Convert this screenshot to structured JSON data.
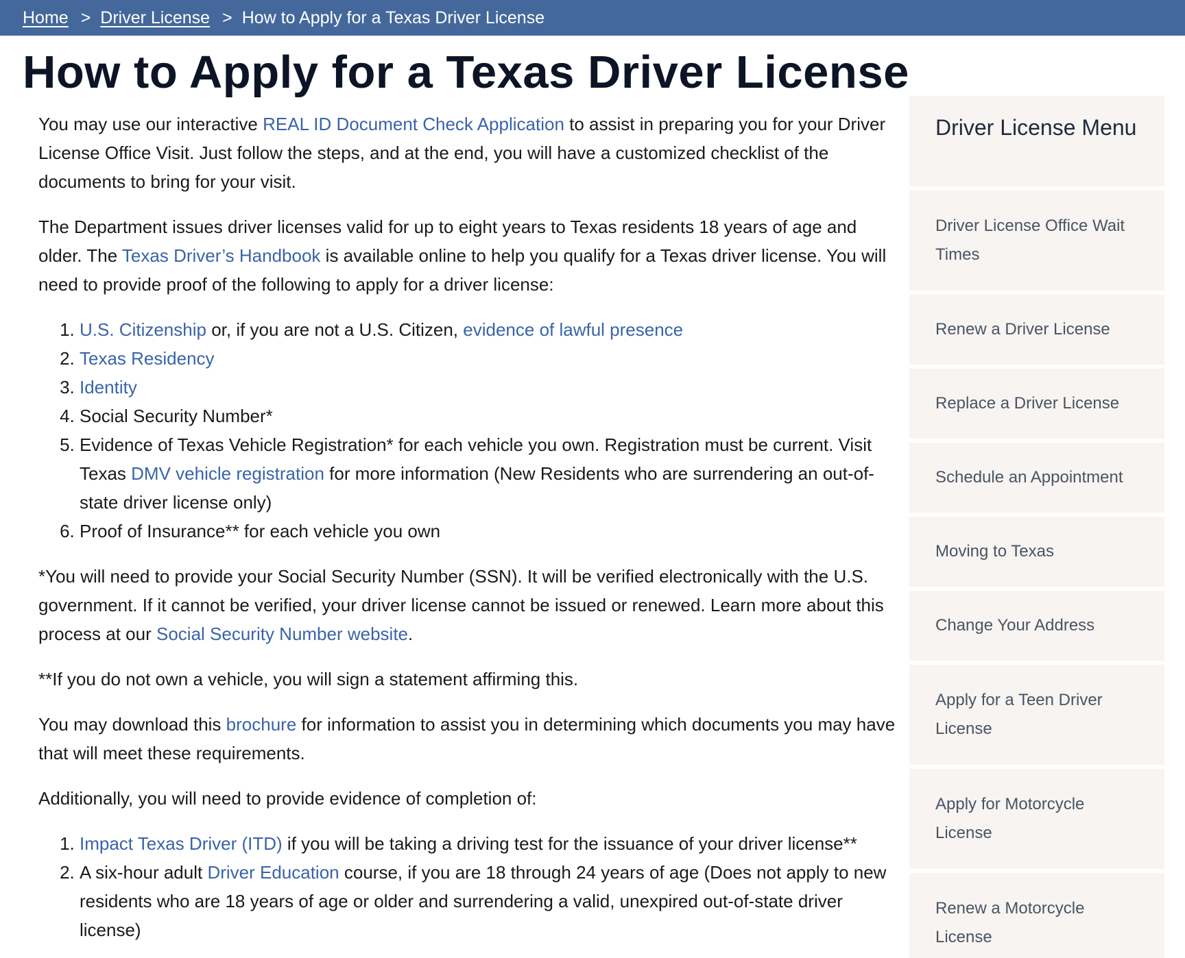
{
  "breadcrumb": {
    "home": "Home",
    "driver_license": "Driver License",
    "current": "How to Apply for a Texas Driver License",
    "separator": ">"
  },
  "title": "How to Apply for a Texas Driver License",
  "intro": {
    "before": "You may use our interactive ",
    "link": "REAL ID Document Check Application",
    "after": " to assist in preparing you for your Driver License Office Visit. Just follow the steps, and at the end, you will have a customized checklist of the documents to bring for your visit."
  },
  "para2": {
    "before": "The Department issues driver licenses valid for up to eight years to Texas residents 18 years of age and older. The ",
    "link": "Texas Driver’s Handbook",
    "after": " is available online to help you qualify for a Texas driver license. You will need to provide proof of the following to apply for a driver license:"
  },
  "list1": {
    "item1_link1": "U.S. Citizenship",
    "item1_mid": " or, if you are not a U.S. Citizen, ",
    "item1_link2": "evidence of lawful presence",
    "item2_link": "Texas Residency",
    "item3_link": "Identity",
    "item4": "Social Security Number*",
    "item5_before": "Evidence of Texas Vehicle Registration* for each vehicle you own. Registration must be current. Visit Texas ",
    "item5_link": "DMV vehicle registration",
    "item5_after": " for more information (New Residents who are surrendering an out-of-state driver license only)",
    "item6": "Proof of Insurance** for each vehicle you own"
  },
  "ssn_note": {
    "before": "*You will need to provide your Social Security Number (SSN). It will be verified electronically with the U.S. government. If it cannot be verified, your driver license cannot be issued or renewed. Learn more about this process at our ",
    "link": "Social Security Number website",
    "after": "."
  },
  "vehicle_note": "**If you do not own a vehicle, you will sign a statement affirming this.",
  "brochure": {
    "before": "You may download this ",
    "link": "brochure",
    "after": " for information to assist you in determining which documents you may have that will meet these requirements."
  },
  "additionally": "Additionally, you will need to provide evidence of completion of:",
  "list2": {
    "item1_link": "Impact Texas Driver (ITD)",
    "item1_after": " if you will be taking a driving test for the issuance of your driver license**",
    "item2_before": "A six-hour adult ",
    "item2_link": "Driver Education",
    "item2_after": " course, if you are 18 through 24 years of age  (Does not apply to new residents who are 18 years of age or older and surrendering a valid, unexpired out-of-state driver license)"
  },
  "sidebar": {
    "heading": "Driver License Menu",
    "items": [
      "Driver License Office Wait Times",
      "Renew a Driver License",
      "Replace a Driver License",
      "Schedule an Appointment",
      "Moving to Texas",
      "Change Your Address",
      "Apply for a Teen Driver License",
      "Apply for Motorcycle License",
      "Renew a Motorcycle License"
    ]
  }
}
